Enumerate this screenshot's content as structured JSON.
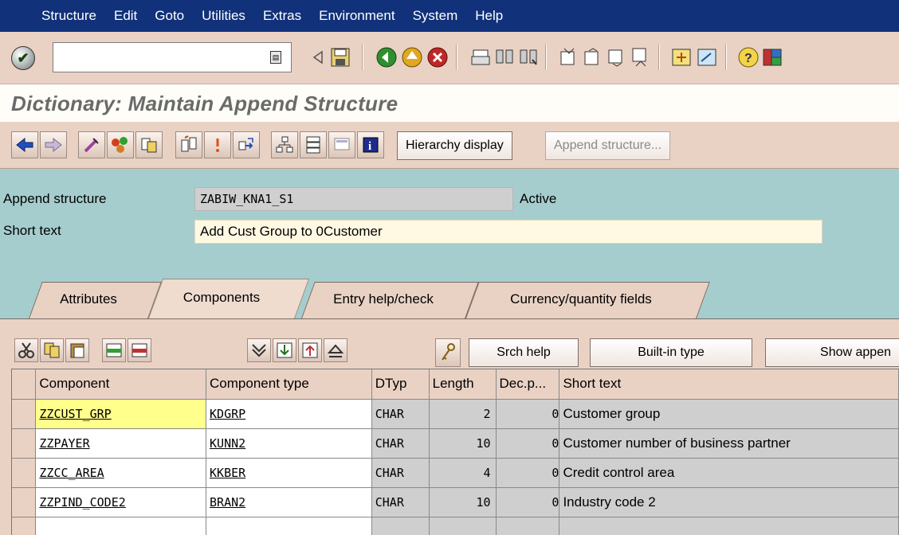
{
  "menu": [
    "Structure",
    "Edit",
    "Goto",
    "Utilities",
    "Extras",
    "Environment",
    "System",
    "Help"
  ],
  "command_field": {
    "value": ""
  },
  "title": "Dictionary: Maintain Append Structure",
  "toolbar": {
    "hierarchy_display": "Hierarchy display",
    "append_structure": "Append structure..."
  },
  "header": {
    "append_structure_label": "Append structure",
    "append_structure_value": "ZABIW_KNA1_S1",
    "status": "Active",
    "short_text_label": "Short text",
    "short_text_value": "Add Cust Group to 0Customer"
  },
  "tabs": [
    {
      "label": "Attributes",
      "active": false
    },
    {
      "label": "Components",
      "active": true
    },
    {
      "label": "Entry help/check",
      "active": false
    },
    {
      "label": "Currency/quantity fields",
      "active": false
    }
  ],
  "table_toolbar": {
    "srch_help": "Srch help",
    "builtin_type": "Built-in type",
    "show_append": "Show appen"
  },
  "table": {
    "columns": [
      "Component",
      "Component type",
      "DTyp",
      "Length",
      "Dec.p...",
      "Short text"
    ],
    "rows": [
      {
        "component": "ZZCUST_GRP",
        "type": "KDGRP",
        "dtyp": "CHAR",
        "length": "2",
        "dec": "0",
        "short_text": "Customer group"
      },
      {
        "component": "ZZPAYER",
        "type": "KUNN2",
        "dtyp": "CHAR",
        "length": "10",
        "dec": "0",
        "short_text": "Customer number of business partner"
      },
      {
        "component": "ZZCC_AREA",
        "type": "KKBER",
        "dtyp": "CHAR",
        "length": "4",
        "dec": "0",
        "short_text": "Credit control area"
      },
      {
        "component": "ZZPIND_CODE2",
        "type": "BRAN2",
        "dtyp": "CHAR",
        "length": "10",
        "dec": "0",
        "short_text": "Industry code 2"
      }
    ]
  },
  "colors": {
    "menubar": "#11327a",
    "header_bg": "#a6cdcd",
    "panel_bg": "#e9d2c4",
    "highlight": "#ffff8c"
  }
}
